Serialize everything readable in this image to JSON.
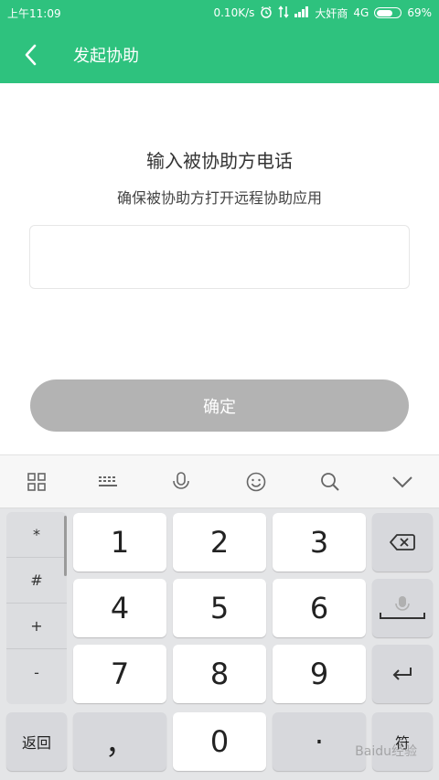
{
  "status": {
    "time": "上午11:09",
    "speed": "0.10K/s",
    "carrier": "大奸商",
    "network": "4G",
    "battery": "69%",
    "battery_level": 0.69
  },
  "header": {
    "title": "发起协助"
  },
  "main": {
    "heading": "输入被协助方电话",
    "subheading": "确保被协助方打开远程协助应用",
    "phone_value": "",
    "phone_placeholder": "",
    "confirm_label": "确定"
  },
  "toolbar": {
    "icons": [
      "grid-icon",
      "keyboard-icon",
      "microphone-icon",
      "emoji-icon",
      "search-icon",
      "chevron-down-icon"
    ]
  },
  "keyboard": {
    "side_keys": [
      "*",
      "#",
      "+",
      "-"
    ],
    "digits": [
      "1",
      "2",
      "3",
      "4",
      "5",
      "6",
      "7",
      "8",
      "9"
    ],
    "back_label": "返回",
    "comma": "，",
    "zero": "0",
    "dot": "·",
    "symbol_label": "符",
    "watermark": "Baidu经验"
  },
  "colors": {
    "accent": "#2ec27e",
    "button_disabled": "#b3b3b3",
    "keyboard_bg": "#e4e5e7"
  }
}
